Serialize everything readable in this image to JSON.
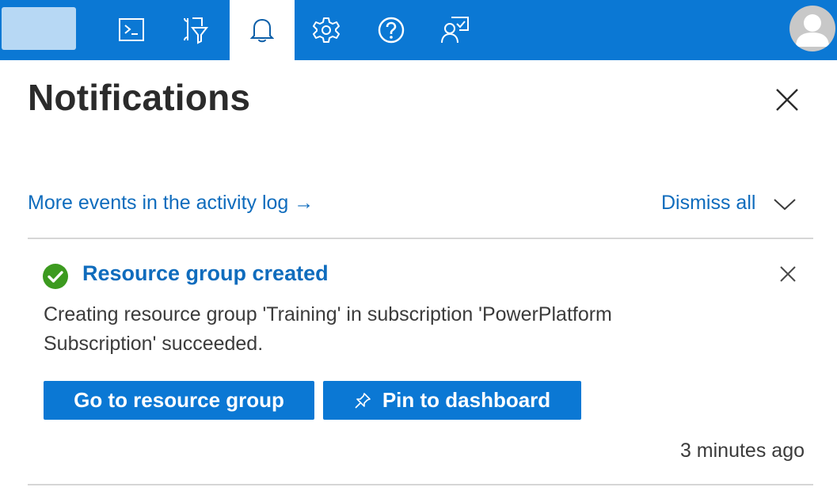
{
  "topbar": {
    "icons": [
      {
        "name": "cloud-shell-icon"
      },
      {
        "name": "directory-filter-icon"
      },
      {
        "name": "notifications-bell-icon",
        "active": true
      },
      {
        "name": "settings-gear-icon"
      },
      {
        "name": "help-question-icon"
      },
      {
        "name": "feedback-icon"
      }
    ],
    "accent_color": "#0b78d4"
  },
  "panel": {
    "title": "Notifications",
    "activity_link": "More events in the activity log →",
    "dismiss_all": "Dismiss all"
  },
  "notification": {
    "status": "success",
    "status_color": "#3c9a1f",
    "title": "Resource group created",
    "body": "Creating resource group 'Training' in subscription 'PowerPlatform Subscription' succeeded.",
    "primary_action": "Go to resource group",
    "secondary_action": "Pin to dashboard",
    "timestamp": "3 minutes ago"
  }
}
